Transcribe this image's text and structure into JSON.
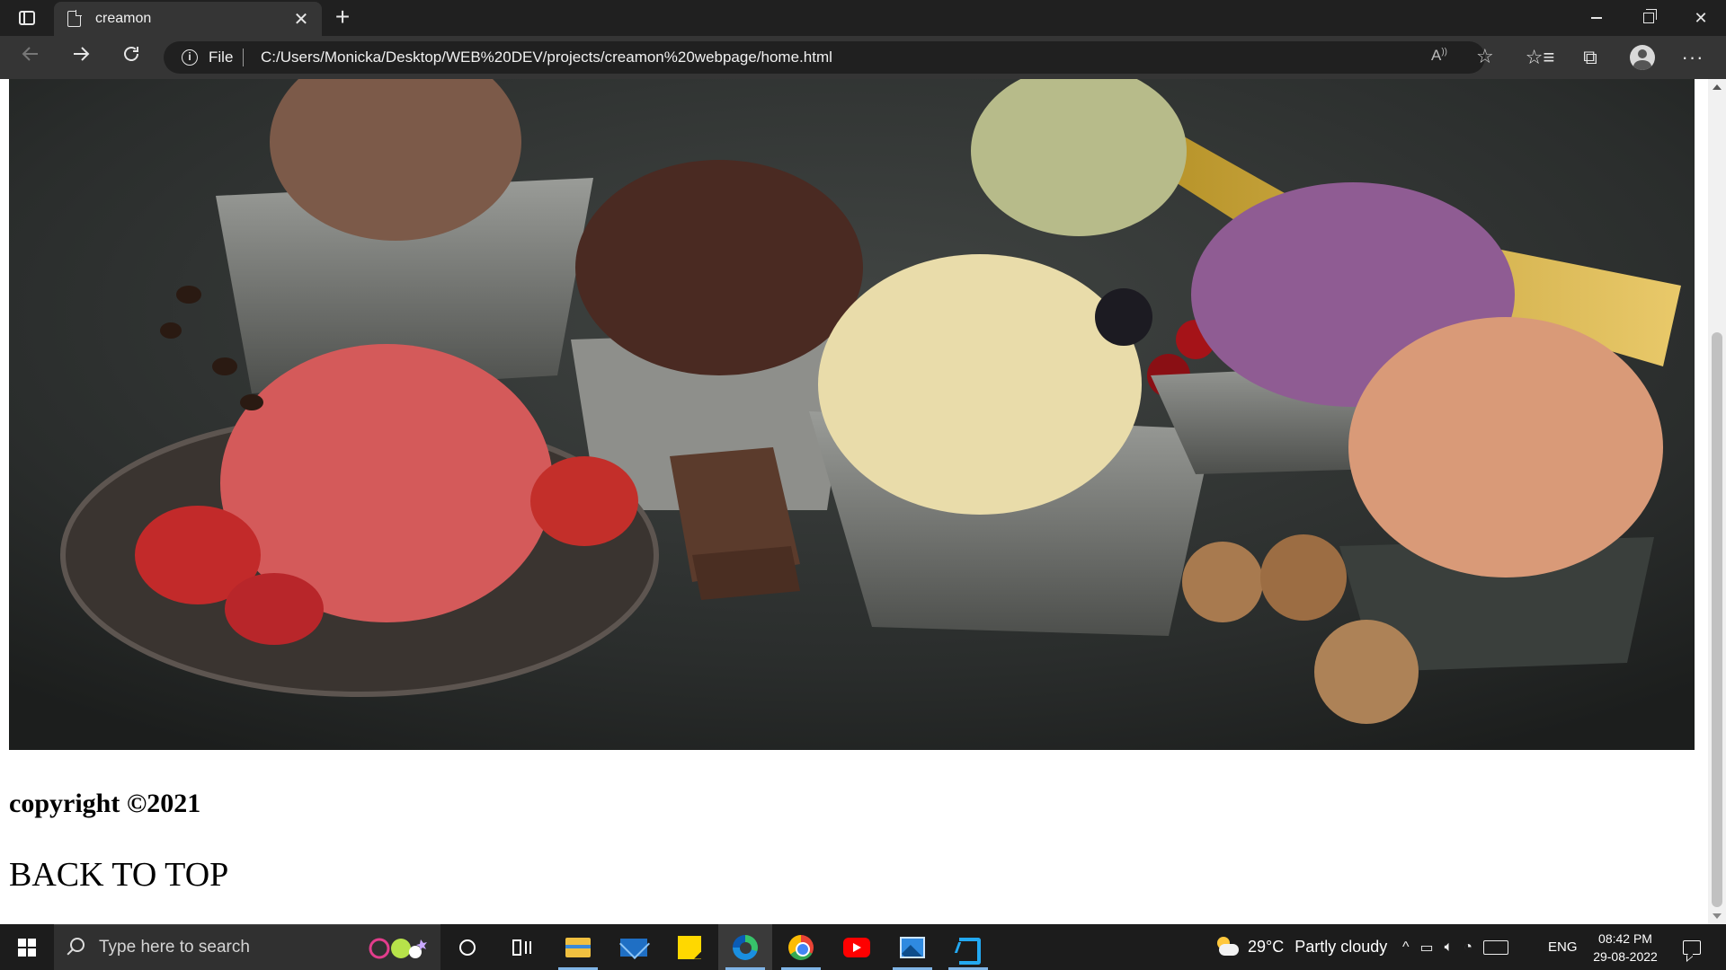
{
  "browser": {
    "tab": {
      "title": "creamon",
      "icon": "document-icon"
    },
    "new_tab_symbol": "+",
    "close_tab_symbol": "✕",
    "address": {
      "scheme_label": "File",
      "url": "C:/Users/Monicka/Desktop/WEB%20DEV/projects/creamon%20webpage/home.html"
    },
    "toolbar_icons": [
      "back-icon",
      "forward-icon",
      "refresh-icon",
      "read-aloud-icon",
      "add-favorite-icon",
      "favorites-icon",
      "collections-icon",
      "profile-icon",
      "more-icon"
    ],
    "window_controls": [
      "minimize-icon",
      "restore-icon",
      "close-icon"
    ]
  },
  "page": {
    "hero_image_alt": "ice cream scoops",
    "copyright": "copyright ©2021",
    "back_to_top": "BACK TO TOP"
  },
  "taskbar": {
    "search_placeholder": "Type here to search",
    "apps": [
      "cortana-icon",
      "task-view-icon",
      "file-explorer-icon",
      "mail-icon",
      "sticky-notes-icon",
      "edge-icon",
      "chrome-icon",
      "youtube-icon",
      "photos-icon",
      "vscode-icon"
    ],
    "weather": {
      "temp": "29°C",
      "condition": "Partly cloudy"
    },
    "language": "ENG",
    "time": "08:42 PM",
    "date": "29-08-2022"
  },
  "colors": {
    "browser_chrome": "#202020",
    "toolbar": "#353535",
    "taskbar": "#1c1c1c",
    "page_bg": "#ffffff"
  }
}
